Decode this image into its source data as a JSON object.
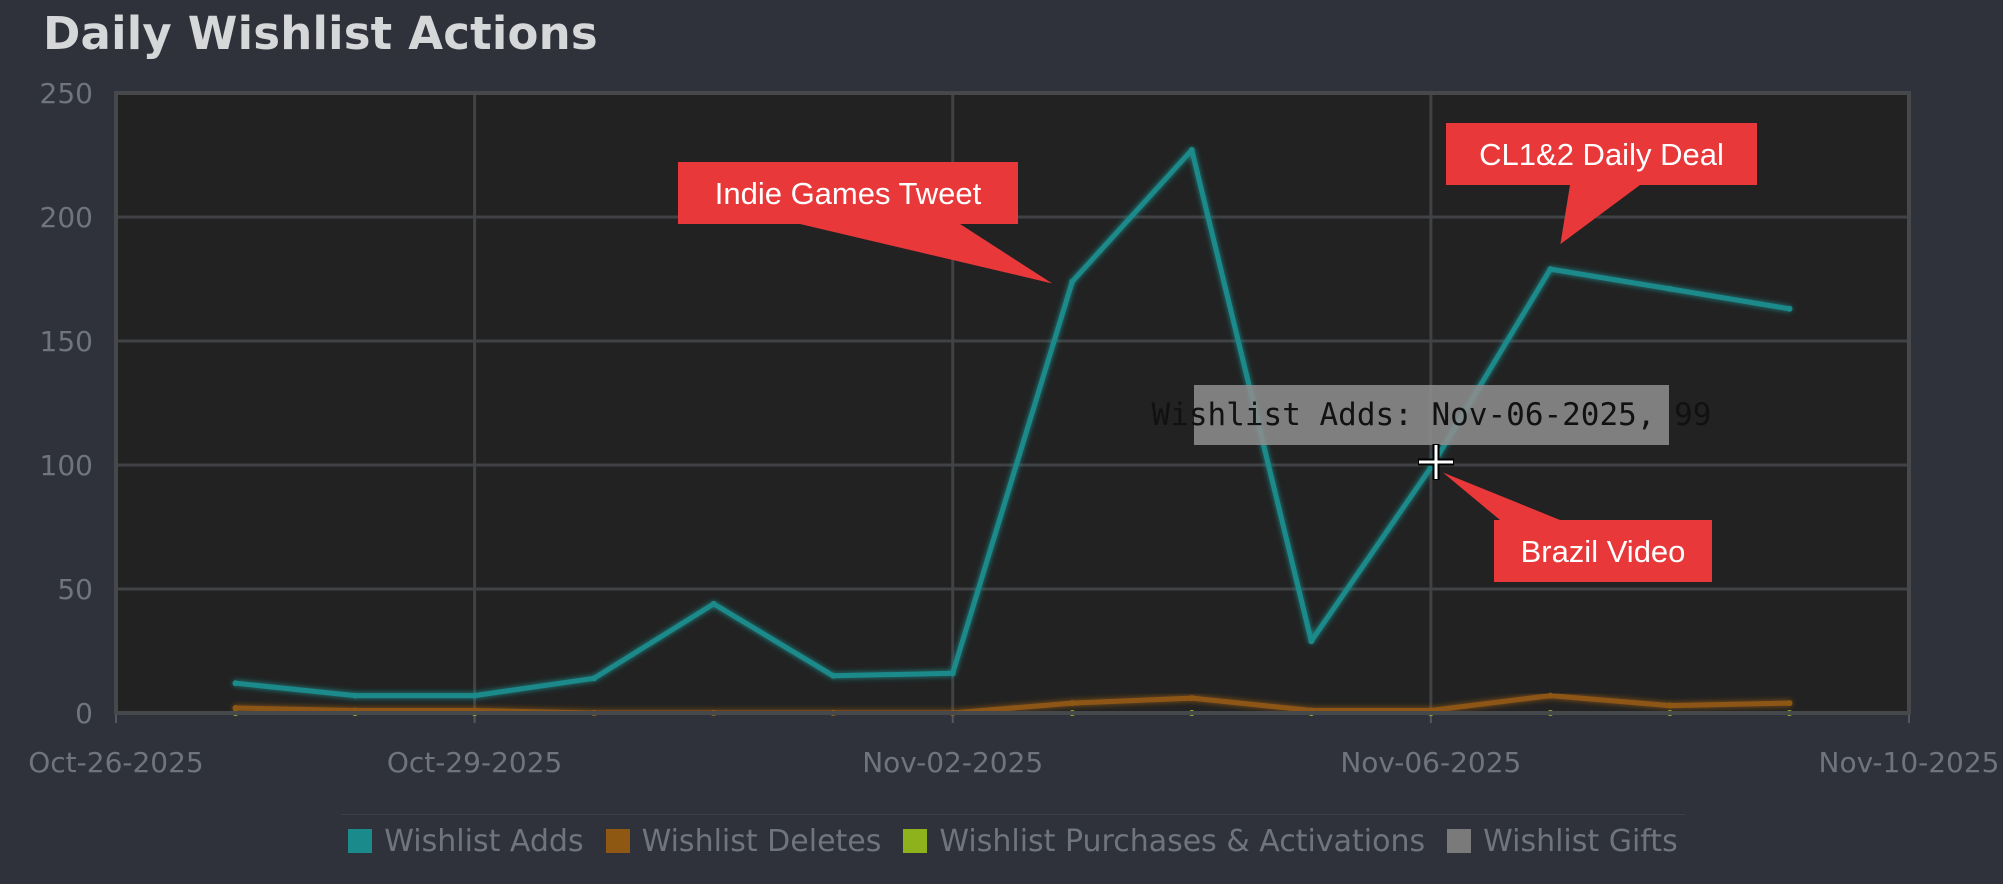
{
  "page": {
    "title": "Daily Wishlist Actions"
  },
  "colors": {
    "background": "#2f323a",
    "plot_background": "#222222",
    "grid": "#404246",
    "wishlist_adds": "#1a8a8a",
    "wishlist_deletes": "#8e5712",
    "wishlist_purchases": "#8db21b",
    "wishlist_gifts": "#7a7a7a",
    "annotation": "#e8383a"
  },
  "chart_data": {
    "type": "line",
    "title": "Daily Wishlist Actions",
    "xlabel": "",
    "ylabel": "",
    "xlim": [
      "2025-10-26",
      "2025-11-10"
    ],
    "ylim": [
      0,
      250
    ],
    "x_ticks": [
      "Oct-26-2025",
      "Oct-29-2025",
      "Nov-02-2025",
      "Nov-06-2025",
      "Nov-10-2025"
    ],
    "y_ticks": [
      0,
      50,
      100,
      150,
      200,
      250
    ],
    "grid": true,
    "legend_position": "bottom",
    "x": [
      "2025-10-27",
      "2025-10-28",
      "2025-10-29",
      "2025-10-30",
      "2025-10-31",
      "2025-11-01",
      "2025-11-02",
      "2025-11-03",
      "2025-11-04",
      "2025-11-05",
      "2025-11-06",
      "2025-11-07",
      "2025-11-08",
      "2025-11-09"
    ],
    "series": [
      {
        "name": "Wishlist Adds",
        "color": "#1a8a8a",
        "values": [
          12,
          7,
          7,
          14,
          44,
          15,
          16,
          174,
          227,
          29,
          99,
          179,
          171,
          163
        ]
      },
      {
        "name": "Wishlist Deletes",
        "color": "#8e5712",
        "values": [
          2,
          1,
          1,
          0,
          0,
          0,
          0,
          4,
          6,
          1,
          1,
          7,
          3,
          4
        ]
      },
      {
        "name": "Wishlist Purchases & Activations",
        "color": "#8db21b",
        "values": [
          0,
          0,
          0,
          0,
          0,
          0,
          0,
          0,
          0,
          0,
          0,
          0,
          0,
          0
        ]
      },
      {
        "name": "Wishlist Gifts",
        "color": "#7a7a7a",
        "values": [
          0,
          0,
          0,
          0,
          0,
          0,
          0,
          0,
          0,
          0,
          0,
          0,
          0,
          0
        ]
      }
    ],
    "annotations": [
      {
        "text": "Indie Games Tweet",
        "x": "2025-11-03",
        "y": 174
      },
      {
        "text": "CL1&2 Daily Deal",
        "x": "2025-11-07",
        "y": 179
      },
      {
        "text": "Brazil Video",
        "x": "2025-11-06",
        "y": 99
      }
    ]
  },
  "tooltip": {
    "text": "Wishlist Adds: Nov-06-2025, 99"
  },
  "legend": {
    "items": [
      {
        "label": "Wishlist Adds",
        "color": "#1a8a8a"
      },
      {
        "label": "Wishlist Deletes",
        "color": "#8e5712"
      },
      {
        "label": "Wishlist Purchases & Activations",
        "color": "#8db21b"
      },
      {
        "label": "Wishlist Gifts",
        "color": "#7a7a7a"
      }
    ]
  }
}
